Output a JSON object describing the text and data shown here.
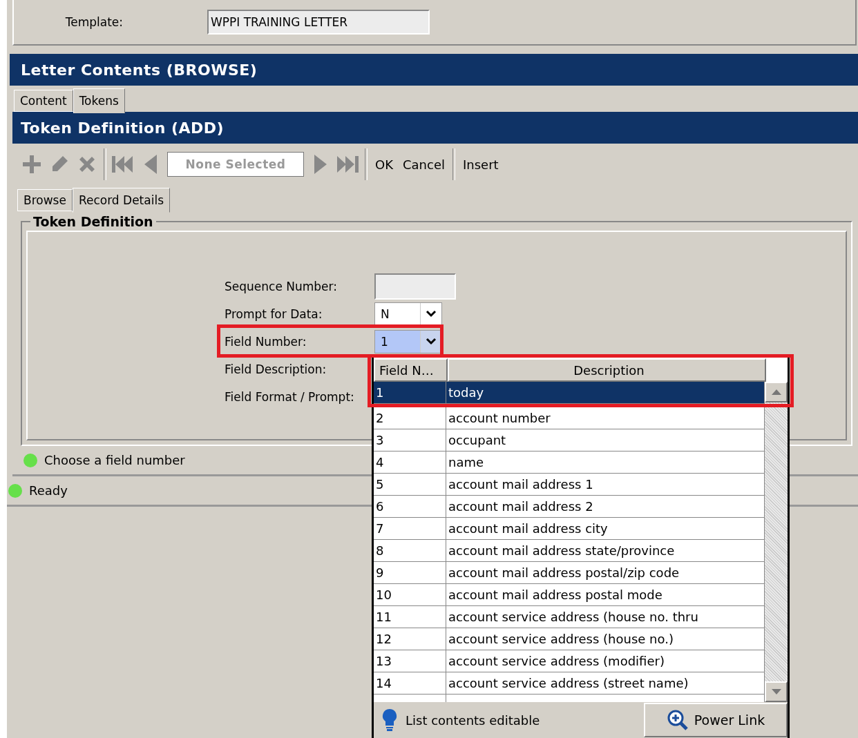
{
  "template": {
    "label": "Template:",
    "value": "WPPI TRAINING LETTER"
  },
  "letter_header": "Letter Contents (BROWSE)",
  "outer_tabs": [
    {
      "label": "Content",
      "selected": false
    },
    {
      "label": "Tokens",
      "selected": true
    }
  ],
  "token_header": "Token Definition (ADD)",
  "toolbar": [
    {
      "kind": "add",
      "disabled": true
    },
    {
      "kind": "edit",
      "disabled": true
    },
    {
      "kind": "delete",
      "disabled": true
    },
    {
      "kind": "separator"
    },
    {
      "kind": "first",
      "disabled": true
    },
    {
      "kind": "prev",
      "disabled": true
    },
    {
      "kind": "selector",
      "placeholder": "None Selected"
    },
    {
      "kind": "next",
      "disabled": true
    },
    {
      "kind": "last",
      "disabled": true
    },
    {
      "kind": "separator"
    },
    {
      "kind": "text",
      "label": "OK",
      "disabled": false
    },
    {
      "kind": "text",
      "label": "Cancel",
      "disabled": false
    },
    {
      "kind": "separator"
    },
    {
      "kind": "text",
      "label": "Insert",
      "disabled": false
    }
  ],
  "inner_tabs": [
    {
      "label": "Browse",
      "selected": false
    },
    {
      "label": "Record Details",
      "selected": true
    }
  ],
  "group": {
    "title": "Token Definition",
    "fields": [
      {
        "kind": "text",
        "label": "Sequence Number:"
      },
      {
        "kind": "combo",
        "label": "Prompt for Data:",
        "value": "N",
        "focused": false
      },
      {
        "kind": "combo",
        "label": "Field Number:",
        "value": "1",
        "focused": true
      },
      {
        "kind": "none",
        "label": "Field Description:"
      },
      {
        "kind": "none",
        "label": "Field Format / Prompt:"
      }
    ]
  },
  "hint": "Choose a field number",
  "status": "Ready",
  "dropdown": {
    "columns": [
      "Field N…",
      "Description"
    ],
    "rows": [
      {
        "number": "1",
        "description": "today",
        "selected": true
      },
      {
        "number": "2",
        "description": "account number",
        "selected": false
      },
      {
        "number": "3",
        "description": "occupant",
        "selected": false
      },
      {
        "number": "4",
        "description": "name",
        "selected": false
      },
      {
        "number": "5",
        "description": "account mail address 1",
        "selected": false
      },
      {
        "number": "6",
        "description": "account mail address 2",
        "selected": false
      },
      {
        "number": "7",
        "description": "account mail address city",
        "selected": false
      },
      {
        "number": "8",
        "description": "account mail address state/province",
        "selected": false
      },
      {
        "number": "9",
        "description": "account mail address postal/zip code",
        "selected": false
      },
      {
        "number": "10",
        "description": "account mail address postal mode",
        "selected": false
      },
      {
        "number": "11",
        "description": "account service address (house no. thru",
        "selected": false
      },
      {
        "number": "12",
        "description": "account service address (house no.)",
        "selected": false
      },
      {
        "number": "13",
        "description": "account service address (modifier)",
        "selected": false
      },
      {
        "number": "14",
        "description": "account service address (street name)",
        "selected": false
      }
    ],
    "footer_note": "List contents editable",
    "power_link": "Power Link"
  }
}
